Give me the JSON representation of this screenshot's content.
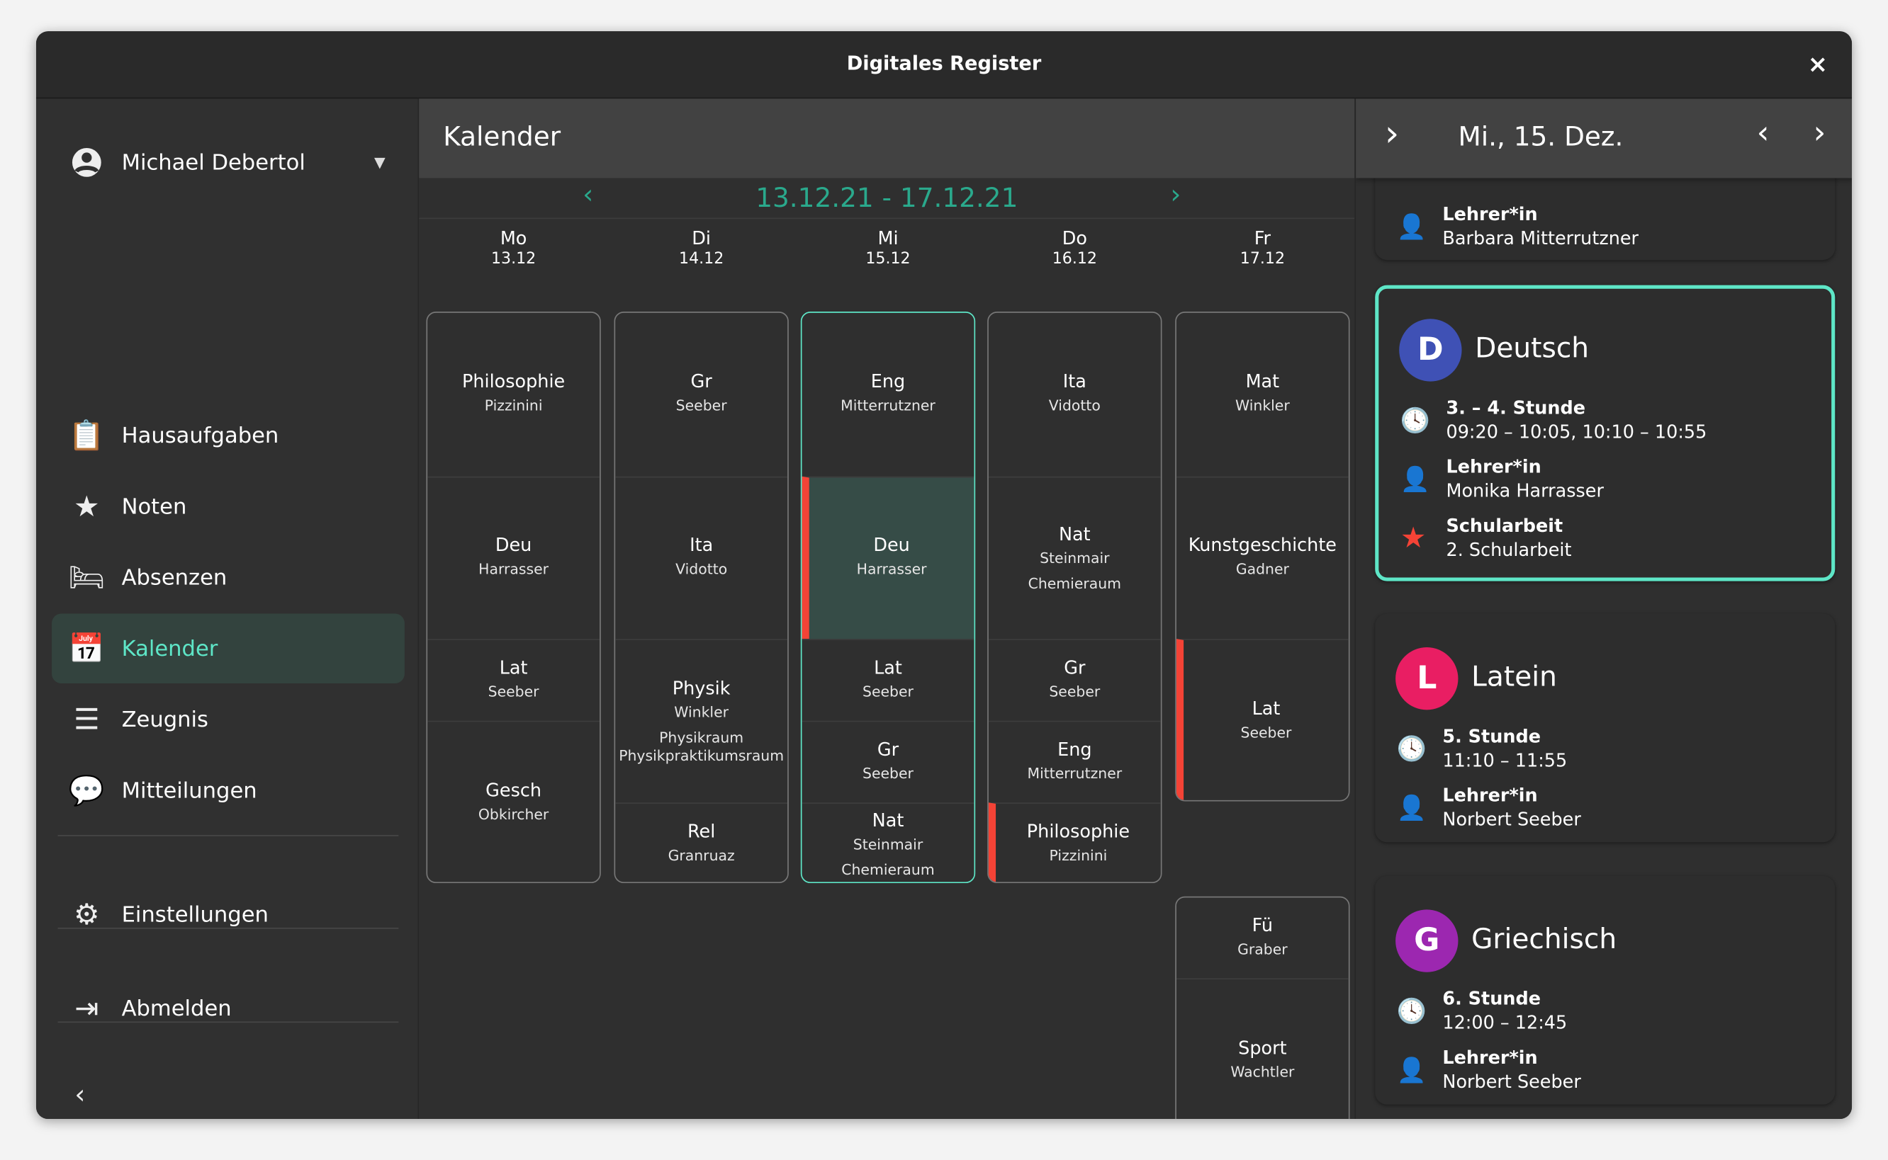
{
  "window": {
    "title": "Digitales Register",
    "close_label": "×"
  },
  "sidebar": {
    "user": "Michael Debertol",
    "items": [
      {
        "label": "Hausaufgaben",
        "icon": "clipboard-icon",
        "glyph": "📋"
      },
      {
        "label": "Noten",
        "icon": "star-icon",
        "glyph": "★"
      },
      {
        "label": "Absenzen",
        "icon": "bed-icon",
        "glyph": "🛏"
      },
      {
        "label": "Kalender",
        "icon": "calendar-icon",
        "glyph": "📅",
        "selected": true
      },
      {
        "label": "Zeugnis",
        "icon": "list-icon",
        "glyph": "☰"
      },
      {
        "label": "Mitteilungen",
        "icon": "message-icon",
        "glyph": "💬"
      }
    ],
    "settings": "Einstellungen",
    "logout": "Abmelden"
  },
  "main": {
    "title": "Kalender",
    "week": "13.12.21 - 17.12.21",
    "days": [
      {
        "name": "Mo",
        "date": "13.12",
        "blocks": [
          {
            "lessons": [
              {
                "subject": "Philosophie",
                "teacher": "Pizzinini",
                "from": 1,
                "to": 2
              },
              {
                "subject": "Deu",
                "teacher": "Harrasser",
                "from": 3,
                "to": 4
              },
              {
                "subject": "Lat",
                "teacher": "Seeber",
                "from": 5,
                "to": 5
              },
              {
                "subject": "Gesch",
                "teacher": "Obkircher",
                "from": 6,
                "to": 7
              }
            ]
          }
        ]
      },
      {
        "name": "Di",
        "date": "14.12",
        "blocks": [
          {
            "lessons": [
              {
                "subject": "Gr",
                "teacher": "Seeber",
                "from": 1,
                "to": 2
              },
              {
                "subject": "Ita",
                "teacher": "Vidotto",
                "from": 3,
                "to": 4
              },
              {
                "subject": "Physik",
                "teacher": "Winkler",
                "room": "Physikraum Physikpraktikumsraum",
                "from": 5,
                "to": 6
              },
              {
                "subject": "Rel",
                "teacher": "Granruaz",
                "from": 7,
                "to": 7
              }
            ]
          }
        ]
      },
      {
        "name": "Mi",
        "date": "15.12",
        "today": true,
        "blocks": [
          {
            "lessons": [
              {
                "subject": "Eng",
                "teacher": "Mitterrutzner",
                "from": 1,
                "to": 2
              },
              {
                "subject": "Deu",
                "teacher": "Harrasser",
                "from": 3,
                "to": 4,
                "selected": true,
                "test": true
              },
              {
                "subject": "Lat",
                "teacher": "Seeber",
                "from": 5,
                "to": 5
              },
              {
                "subject": "Gr",
                "teacher": "Seeber",
                "from": 6,
                "to": 6
              },
              {
                "subject": "Nat",
                "teacher": "Steinmair",
                "room": "Chemieraum",
                "from": 7,
                "to": 7
              }
            ]
          }
        ]
      },
      {
        "name": "Do",
        "date": "16.12",
        "blocks": [
          {
            "lessons": [
              {
                "subject": "Ita",
                "teacher": "Vidotto",
                "from": 1,
                "to": 2
              },
              {
                "subject": "Nat",
                "teacher": "Steinmair",
                "room": "Chemieraum",
                "from": 3,
                "to": 4
              },
              {
                "subject": "Gr",
                "teacher": "Seeber",
                "from": 5,
                "to": 5
              },
              {
                "subject": "Eng",
                "teacher": "Mitterrutzner",
                "from": 6,
                "to": 6
              },
              {
                "subject": "Philosophie",
                "teacher": "Pizzinini",
                "from": 7,
                "to": 7,
                "test": true
              }
            ]
          }
        ]
      },
      {
        "name": "Fr",
        "date": "17.12",
        "blocks": [
          {
            "lessons": [
              {
                "subject": "Mat",
                "teacher": "Winkler",
                "from": 1,
                "to": 2
              },
              {
                "subject": "Kunstgeschichte",
                "teacher": "Gadner",
                "from": 3,
                "to": 4
              },
              {
                "subject": "Lat",
                "teacher": "Seeber",
                "from": 5,
                "to": 6,
                "test": true
              }
            ]
          },
          {
            "lessons": [
              {
                "subject": "Fü",
                "teacher": "Graber",
                "from": 8,
                "to": 8
              },
              {
                "subject": "Sport",
                "teacher": "Wachtler",
                "from": 9,
                "to": 10
              }
            ]
          }
        ]
      }
    ]
  },
  "detail": {
    "date": "Mi., 15. Dez.",
    "partial": {
      "label": "Lehrer*in",
      "value": "Barbara Mitterrutzner"
    },
    "cards": [
      {
        "letter": "D",
        "title": "Deutsch",
        "color": "#3f51b5",
        "selected": true,
        "rows": [
          {
            "icon": "clock-icon",
            "label": "3. – 4. Stunde",
            "value": "09:20 – 10:05, 10:10 – 10:55"
          },
          {
            "icon": "person-icon",
            "label": "Lehrer*in",
            "value": "Monika Harrasser"
          },
          {
            "icon": "star-icon",
            "label": "Schularbeit",
            "value": "2. Schularbeit"
          }
        ]
      },
      {
        "letter": "L",
        "title": "Latein",
        "color": "#e91e63",
        "rows": [
          {
            "icon": "clock-icon",
            "label": "5. Stunde",
            "value": "11:10 – 11:55"
          },
          {
            "icon": "person-icon",
            "label": "Lehrer*in",
            "value": "Norbert Seeber"
          }
        ]
      },
      {
        "letter": "G",
        "title": "Griechisch",
        "color": "#9c27b0",
        "rows": [
          {
            "icon": "clock-icon",
            "label": "6. Stunde",
            "value": "12:00 – 12:45"
          },
          {
            "icon": "person-icon",
            "label": "Lehrer*in",
            "value": "Norbert Seeber"
          }
        ]
      }
    ]
  },
  "colors": {
    "accent": "#5ee6c7",
    "test": "#f44336",
    "selected_lesson": "#364c47"
  }
}
